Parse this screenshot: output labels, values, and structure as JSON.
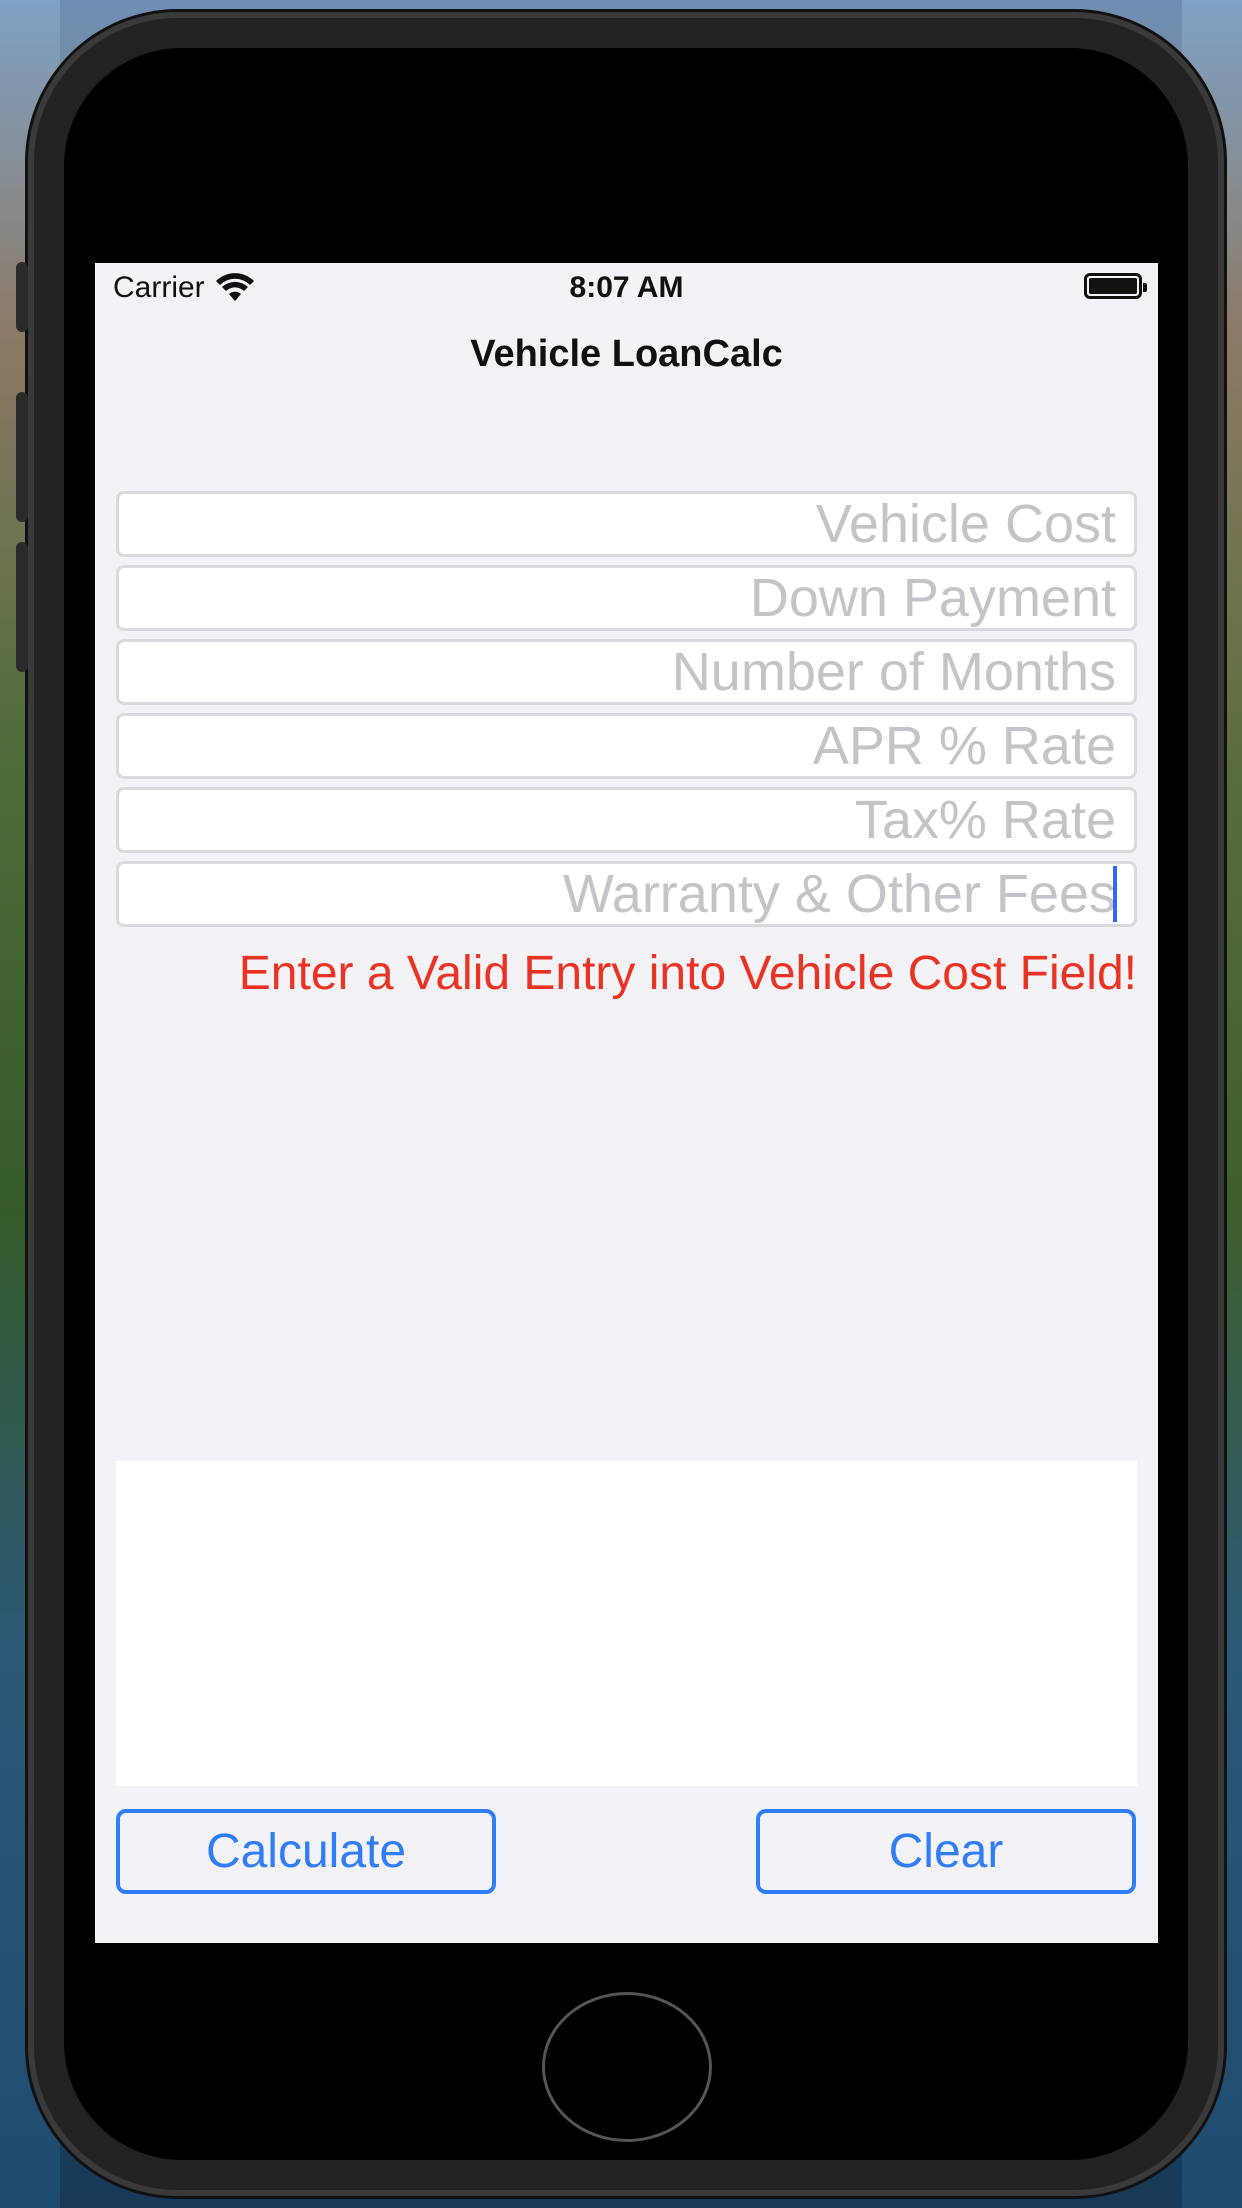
{
  "status_bar": {
    "carrier": "Carrier",
    "time": "8:07 AM",
    "wifi_icon": "wifi-icon",
    "battery_icon": "battery-icon"
  },
  "nav": {
    "title": "Vehicle LoanCalc"
  },
  "fields": [
    {
      "placeholder": "Vehicle Cost",
      "value": ""
    },
    {
      "placeholder": "Down Payment",
      "value": ""
    },
    {
      "placeholder": "Number of Months",
      "value": ""
    },
    {
      "placeholder": "APR % Rate",
      "value": ""
    },
    {
      "placeholder": "Tax% Rate",
      "value": ""
    },
    {
      "placeholder": "Warranty & Other Fees",
      "value": "",
      "focused": true
    }
  ],
  "error_message": "Enter a Valid Entry into Vehicle Cost Field!",
  "result_text": "",
  "buttons": {
    "calculate": "Calculate",
    "clear": "Clear"
  },
  "colors": {
    "accent": "#2f7ef5",
    "error": "#ea3323",
    "background": "#f2f2f7",
    "placeholder": "#c4c4c8"
  }
}
